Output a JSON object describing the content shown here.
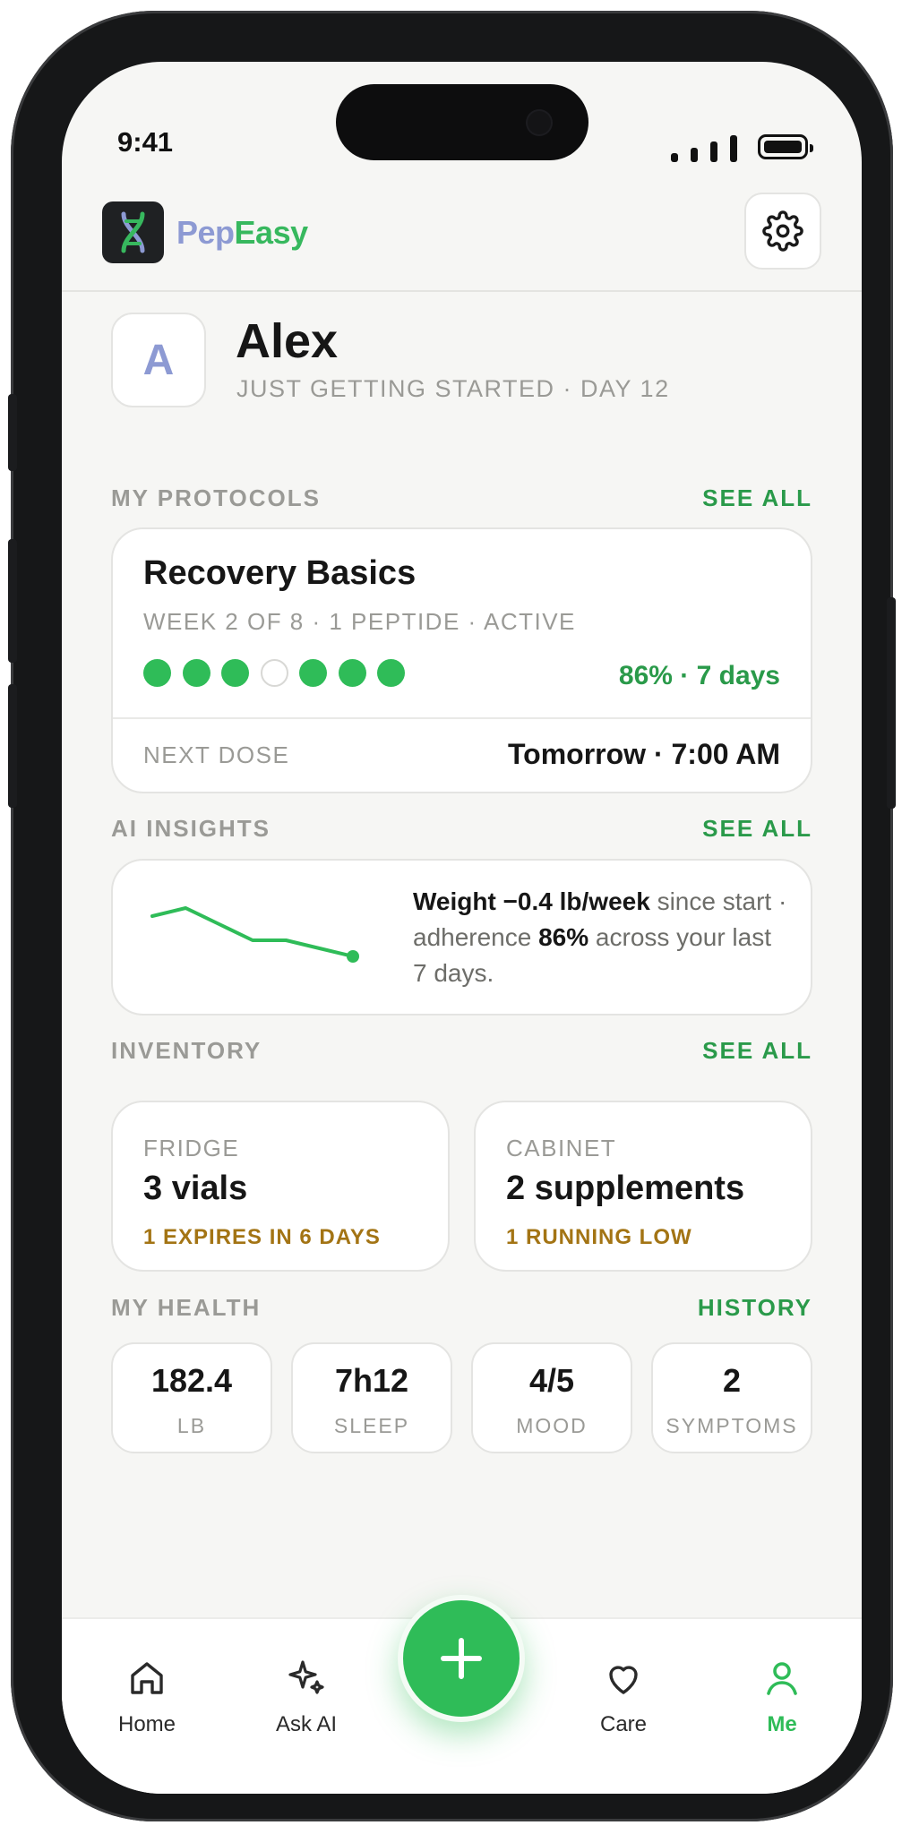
{
  "status_bar": {
    "time": "9:41"
  },
  "header": {
    "brand_part1": "Pep",
    "brand_part2": "Easy",
    "brand_colors": {
      "pep": "#8d9ad3",
      "easy": "#37b85e"
    },
    "logo_icon": "dna-icon",
    "settings_icon": "gear-icon"
  },
  "profile": {
    "avatar_initial": "A",
    "name": "Alex",
    "subtitle": "JUST GETTING STARTED · DAY 12"
  },
  "protocols": {
    "section_title": "MY PROTOCOLS",
    "see_all": "SEE ALL",
    "card": {
      "title": "Recovery Basics",
      "subtitle": "WEEK 2 OF 8 · 1 PEPTIDE · ACTIVE",
      "adherence_days": [
        true,
        true,
        true,
        false,
        true,
        true,
        true
      ],
      "stats": "86% · 7 days",
      "next_dose_label": "NEXT DOSE",
      "next_dose_value": "Tomorrow · 7:00 AM"
    }
  },
  "insights": {
    "section_title": "AI INSIGHTS",
    "see_all": "SEE ALL",
    "text_bold_1": "Weight −0.4 lb/week",
    "text_1": " since start · adherence ",
    "text_bold_2": "86%",
    "text_2": " across your last 7 days.",
    "sparkline": [
      182.8,
      182.9,
      182.7,
      182.5,
      182.5,
      182.4,
      182.3
    ],
    "accent_color": "#2fbc58"
  },
  "inventory": {
    "section_title": "INVENTORY",
    "see_all": "SEE ALL",
    "cards": [
      {
        "label": "FRIDGE",
        "value": "3 vials",
        "note": "1 EXPIRES IN 6 DAYS"
      },
      {
        "label": "CABINET",
        "value": "2 supplements",
        "note": "1 RUNNING LOW"
      }
    ]
  },
  "health": {
    "section_title": "MY HEALTH",
    "history": "HISTORY",
    "metrics": [
      {
        "value": "182.4",
        "label": "LB"
      },
      {
        "value": "7h12",
        "label": "SLEEP"
      },
      {
        "value": "4/5",
        "label": "MOOD"
      },
      {
        "value": "2",
        "label": "SYMPTOMS"
      }
    ]
  },
  "tabbar": {
    "tabs": [
      {
        "label": "Home",
        "icon": "home-icon"
      },
      {
        "label": "Ask AI",
        "icon": "sparkle-icon"
      },
      {
        "label": "Care",
        "icon": "heart-icon"
      },
      {
        "label": "Me",
        "icon": "person-icon"
      }
    ],
    "active": "Me",
    "fab_icon": "plus-icon"
  }
}
